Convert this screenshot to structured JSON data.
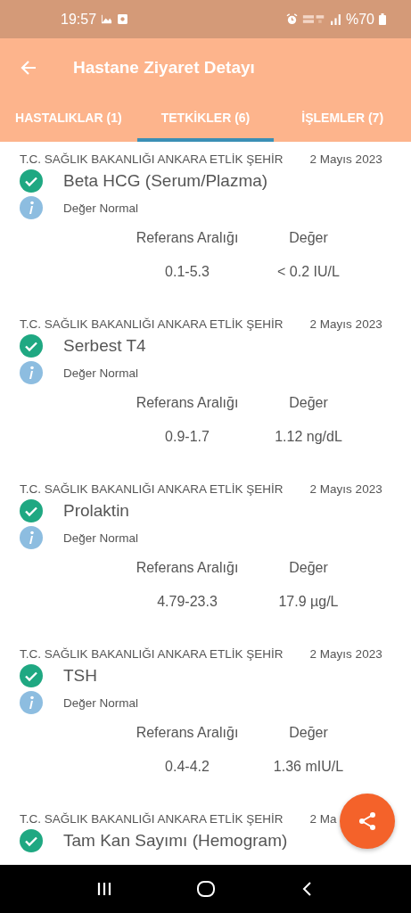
{
  "status_bar": {
    "time": "19:57",
    "battery": "%70"
  },
  "app_bar": {
    "title": "Hastane Ziyaret Detayı"
  },
  "tabs": [
    {
      "label": "HASTALIKLAR (1)",
      "selected": false
    },
    {
      "label": "TETKİKLER (6)",
      "selected": true
    },
    {
      "label": "İŞLEMLER (7)",
      "selected": false
    }
  ],
  "tests": [
    {
      "hospital": "T.C. SAĞLIK BAKANLIĞI ANKARA ETLİK ŞEHİR",
      "date": "2 Mayıs 2023",
      "name": "Beta HCG (Serum/Plazma)",
      "status": "Değer Normal",
      "reference_label": "Referans Aralığı",
      "value_label": "Değer",
      "reference": "0.1-5.3",
      "value": "< 0.2 IU/L"
    },
    {
      "hospital": "T.C. SAĞLIK BAKANLIĞI ANKARA ETLİK ŞEHİR",
      "date": "2 Mayıs 2023",
      "name": "Serbest T4",
      "status": "Değer Normal",
      "reference_label": "Referans Aralığı",
      "value_label": "Değer",
      "reference": "0.9-1.7",
      "value": "1.12 ng/dL"
    },
    {
      "hospital": "T.C. SAĞLIK BAKANLIĞI ANKARA ETLİK ŞEHİR",
      "date": "2 Mayıs 2023",
      "name": "Prolaktin",
      "status": "Değer Normal",
      "reference_label": "Referans Aralığı",
      "value_label": "Değer",
      "reference": "4.79-23.3",
      "value": "17.9 µg/L"
    },
    {
      "hospital": "T.C. SAĞLIK BAKANLIĞI ANKARA ETLİK ŞEHİR",
      "date": "2 Mayıs 2023",
      "name": "TSH",
      "status": "Değer Normal",
      "reference_label": "Referans Aralığı",
      "value_label": "Değer",
      "reference": "0.4-4.2",
      "value": "1.36 mIU/L"
    },
    {
      "hospital": "T.C. SAĞLIK BAKANLIĞI ANKARA ETLİK ŞEHİR",
      "date": "2 Ma",
      "name": "Tam Kan Sayımı (Hemogram)"
    }
  ]
}
